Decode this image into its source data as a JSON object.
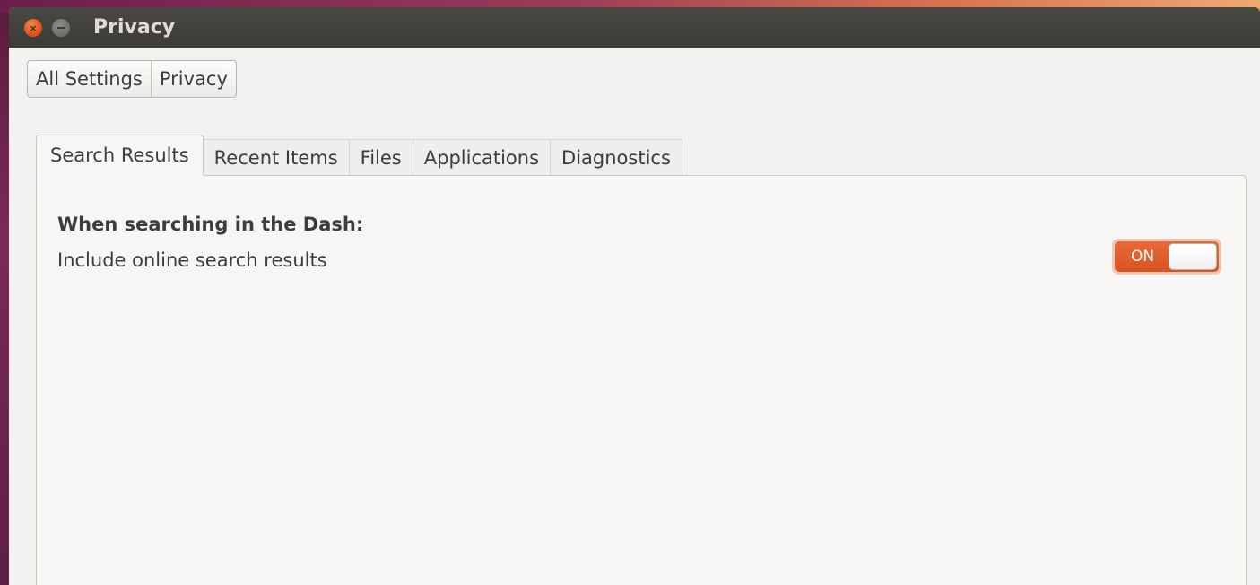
{
  "window": {
    "title": "Privacy",
    "close_symbol": "×"
  },
  "breadcrumb": {
    "items": [
      {
        "label": "All Settings"
      },
      {
        "label": "Privacy"
      }
    ]
  },
  "tabs": [
    {
      "label": "Search Results",
      "active": true
    },
    {
      "label": "Recent Items",
      "active": false
    },
    {
      "label": "Files",
      "active": false
    },
    {
      "label": "Applications",
      "active": false
    },
    {
      "label": "Diagnostics",
      "active": false
    }
  ],
  "search_results": {
    "heading": "When searching in the Dash:",
    "online_results": {
      "label": "Include online search results",
      "toggle_text": "ON",
      "enabled": true
    }
  },
  "colors": {
    "accent": "#dd5a26",
    "titlebar": "#3d3b37",
    "window_bg": "#f2f1f0"
  },
  "icons": {
    "close": "close-icon",
    "minimize": "minimize-icon"
  }
}
